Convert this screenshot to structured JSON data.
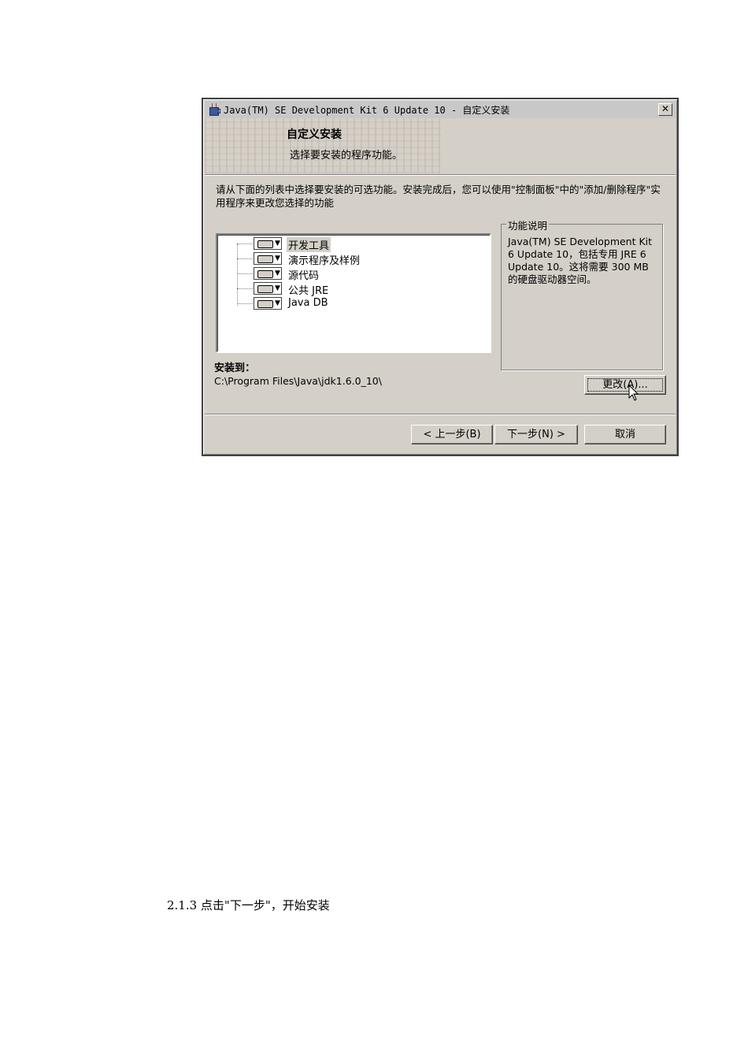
{
  "window": {
    "title": "Java(TM) SE Development Kit 6 Update 10 - 自定义安装",
    "close_label": "✕"
  },
  "banner": {
    "heading": "自定义安装",
    "subheading": "选择要安装的程序功能。"
  },
  "instructions": "请从下面的列表中选择要安装的可选功能。安装完成后，您可以使用\"控制面板\"中的\"添加/删除程序\"实用程序来更改您选择的功能",
  "feature_tree": {
    "items": [
      {
        "label": "开发工具",
        "selected": true
      },
      {
        "label": "演示程序及样例",
        "selected": false
      },
      {
        "label": "源代码",
        "selected": false
      },
      {
        "label": "公共 JRE",
        "selected": false
      },
      {
        "label": "Java DB",
        "selected": false
      }
    ]
  },
  "description": {
    "title": "功能说明",
    "text": "Java(TM) SE Development Kit 6 Update 10，包括专用 JRE 6 Update 10。这将需要 300 MB 的硬盘驱动器空间。"
  },
  "install_location": {
    "label": "安装到：",
    "path": "C:\\Program Files\\Java\\jdk1.6.0_10\\"
  },
  "buttons": {
    "change": "更改(A)...",
    "back": "< 上一步(B)",
    "next": "下一步(N) >",
    "cancel": "取消"
  },
  "caption": "2.1.3  点击\"下一步\"，开始安装"
}
